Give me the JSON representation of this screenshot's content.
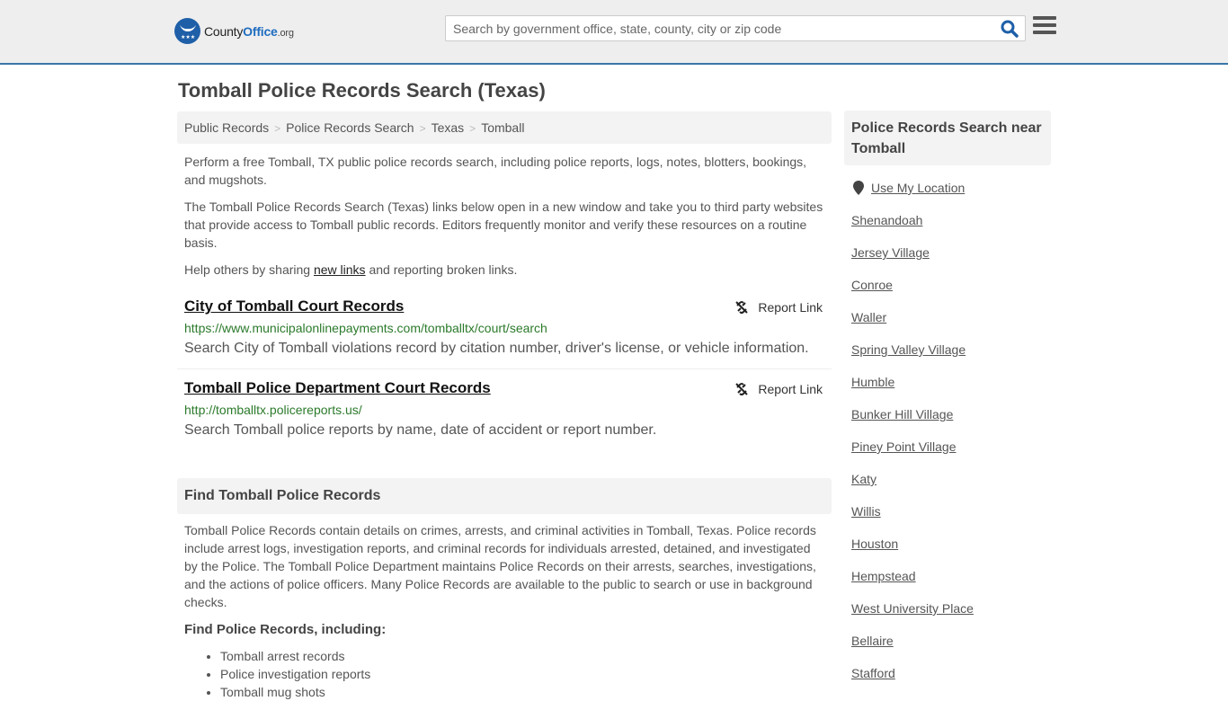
{
  "header": {
    "logo": {
      "county": "County",
      "office": "Office",
      "org": ".org"
    },
    "search": {
      "placeholder": "Search by government office, state, county, city or zip code",
      "value": ""
    },
    "icons": {
      "search": "search-icon",
      "menu": "hamburger-menu-icon",
      "logo": "eagle-stars-logo-icon"
    }
  },
  "page": {
    "title": "Tomball Police Records Search (Texas)"
  },
  "breadcrumb": [
    "Public Records",
    "Police Records Search",
    "Texas",
    "Tomball"
  ],
  "intro": {
    "p1": "Perform a free Tomball, TX public police records search, including police reports, logs, notes, blotters, bookings, and mugshots.",
    "p2": "The Tomball Police Records Search (Texas) links below open in a new window and take you to third party websites that provide access to Tomball public records. Editors frequently monitor and verify these resources on a routine basis.",
    "p3_before": "Help others by sharing ",
    "p3_link": "new links",
    "p3_after": " and reporting broken links."
  },
  "records": [
    {
      "title": "City of Tomball Court Records",
      "url": "https://www.municipalonlinepayments.com/tomballtx/court/search",
      "description": "Search City of Tomball violations record by citation number, driver's license, or vehicle information.",
      "report_label": "Report Link"
    },
    {
      "title": "Tomball Police Department Court Records",
      "url": "http://tomballtx.policereports.us/",
      "description": "Search Tomball police reports by name, date of accident or report number.",
      "report_label": "Report Link"
    }
  ],
  "find_section": {
    "heading": "Find Tomball Police Records",
    "body": "Tomball Police Records contain details on crimes, arrests, and criminal activities in Tomball, Texas. Police records include arrest logs, investigation reports, and criminal records for individuals arrested, detained, and investigated by the Police. The Tomball Police Department maintains Police Records on their arrests, searches, investigations, and the actions of police officers. Many Police Records are available to the public to search or use in background checks.",
    "subheading": "Find Police Records, including:",
    "bullets": [
      "Tomball arrest records",
      "Police investigation reports",
      "Tomball mug shots"
    ]
  },
  "sidebar": {
    "heading": "Police Records Search near Tomball",
    "use_location": "Use My Location",
    "cities": [
      "Shenandoah",
      "Jersey Village",
      "Conroe",
      "Waller",
      "Spring Valley Village",
      "Humble",
      "Bunker Hill Village",
      "Piney Point Village",
      "Katy",
      "Willis",
      "Houston",
      "Hempstead",
      "West University Place",
      "Bellaire",
      "Stafford"
    ]
  },
  "colors": {
    "brand_blue": "#1e5fa8",
    "header_border": "#3a76a8",
    "url_green": "#2b7a2b",
    "panel_gray": "#f3f3f3"
  }
}
